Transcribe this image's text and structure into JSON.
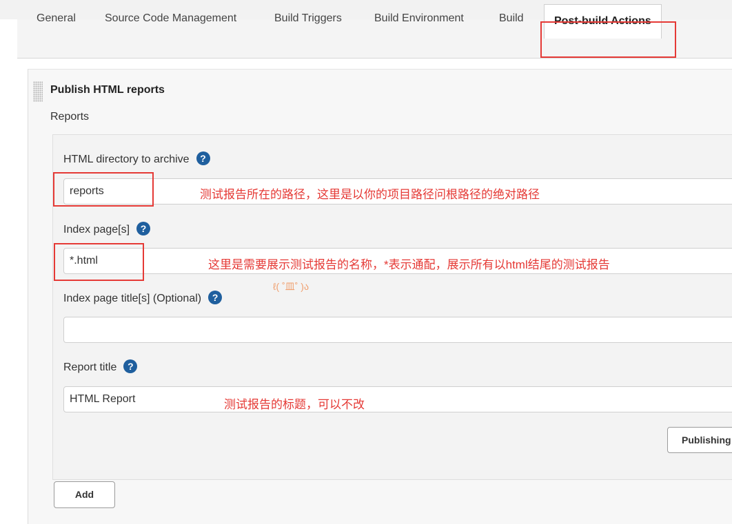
{
  "tabs": [
    {
      "label": "General"
    },
    {
      "label": "Source Code Management"
    },
    {
      "label": "Build Triggers"
    },
    {
      "label": "Build Environment"
    },
    {
      "label": "Build"
    },
    {
      "label": "Post-build Actions",
      "active": true
    }
  ],
  "section": {
    "title": "Publish HTML reports",
    "reports_label": "Reports"
  },
  "fields": {
    "html_dir": {
      "label": "HTML directory to archive",
      "value": "reports",
      "annotation": "测试报告所在的路径，这里是以你的项目路径问根路径的绝对路径"
    },
    "index_pages": {
      "label": "Index page[s]",
      "value": "*.html",
      "annotation": "这里是需要展示测试报告的名称，*表示通配，展示所有以html结尾的测试报告"
    },
    "index_titles": {
      "label": "Index page title[s] (Optional)",
      "value": "",
      "emoticon": "ℓ( ˚皿˚ )ა"
    },
    "report_title": {
      "label": "Report title",
      "value": "HTML Report",
      "annotation": "测试报告的标题，可以不改"
    }
  },
  "help_icon": "?",
  "buttons": {
    "publishing": "Publishing",
    "add": "Add"
  },
  "colors": {
    "annotation": "#e53935",
    "help_icon": "#1f5f9e",
    "highlight_box": "#e53935"
  }
}
